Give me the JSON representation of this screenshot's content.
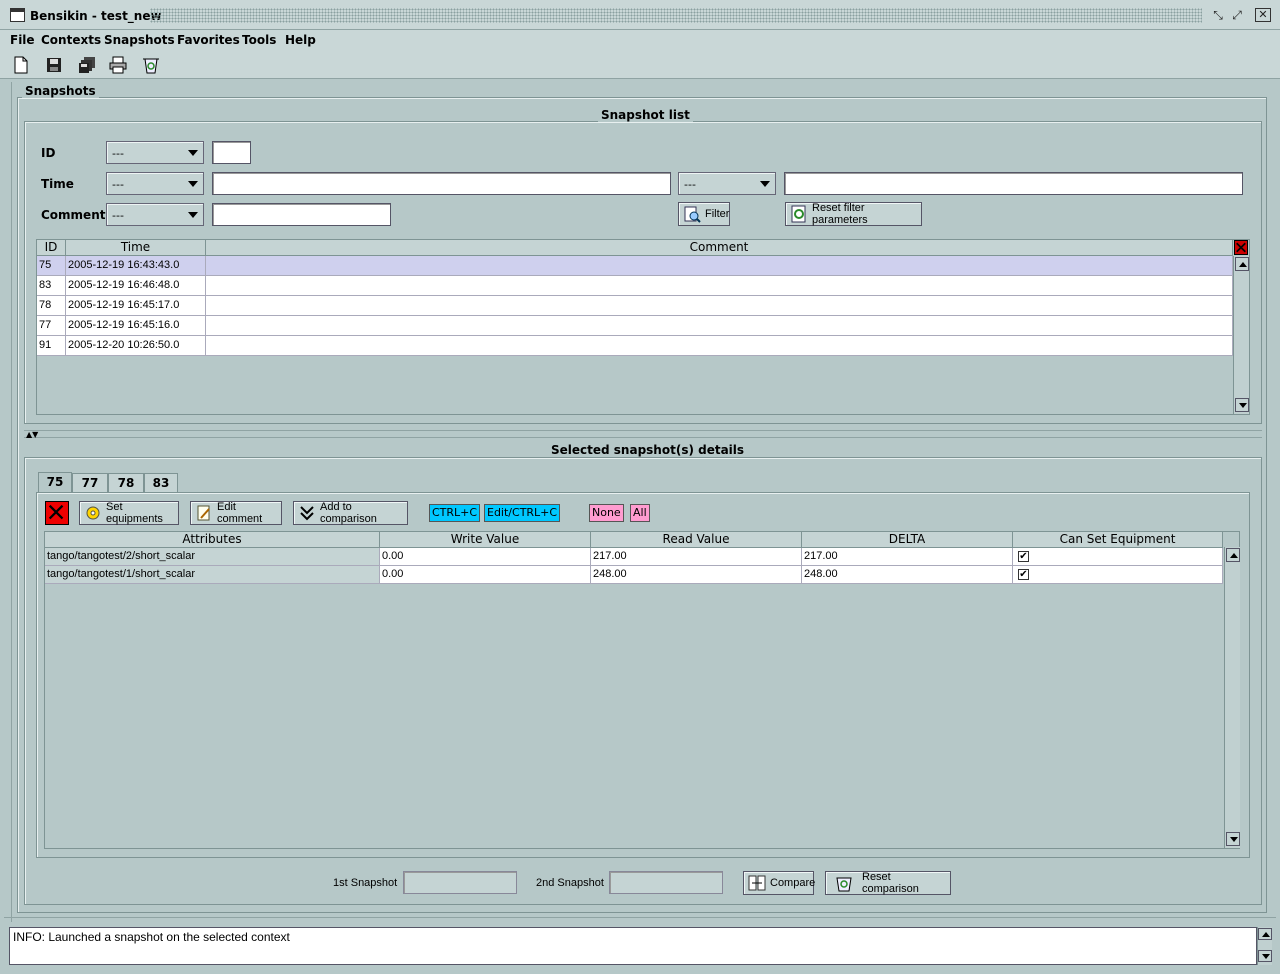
{
  "window": {
    "title": "Bensikin - test_new"
  },
  "menu": [
    "File",
    "Contexts",
    "Snapshots",
    "Favorites",
    "Tools",
    "Help"
  ],
  "toolbar": {
    "icons": [
      "new-file-icon",
      "save-icon",
      "save-all-icon",
      "print-icon",
      "recycle-bin-icon"
    ]
  },
  "panel": {
    "title": "Snapshots"
  },
  "snapshot_list": {
    "title": "Snapshot list",
    "filters": {
      "id_label": "ID",
      "id_combo": "---",
      "id_value": "",
      "time_label": "Time",
      "time_combo": "---",
      "time_value": "",
      "time_combo2": "---",
      "time_value2": "",
      "comment_label": "Comment",
      "comment_combo": "---",
      "comment_value": ""
    },
    "filter_button": "Filter",
    "reset_filter_button": "Reset filter parameters",
    "columns": [
      "ID",
      "Time",
      "Comment"
    ],
    "rows": [
      {
        "id": "75",
        "time": "2005-12-19 16:43:43.0",
        "comment": ""
      },
      {
        "id": "83",
        "time": "2005-12-19 16:46:48.0",
        "comment": ""
      },
      {
        "id": "78",
        "time": "2005-12-19 16:45:17.0",
        "comment": ""
      },
      {
        "id": "77",
        "time": "2005-12-19 16:45:16.0",
        "comment": ""
      },
      {
        "id": "91",
        "time": "2005-12-20 10:26:50.0",
        "comment": ""
      }
    ]
  },
  "details": {
    "title": "Selected snapshot(s) details",
    "tabs": [
      "75",
      "77",
      "78",
      "83"
    ],
    "buttons": {
      "set_equipments": "Set equipments",
      "edit_comment": "Edit comment",
      "add_to_comparison": "Add to comparison",
      "ctrl_c": "CTRL+C",
      "edit_ctrl_c": "Edit/CTRL+C",
      "none": "None",
      "all": "All"
    },
    "columns": [
      "Attributes",
      "Write Value",
      "Read Value",
      "DELTA",
      "Can Set Equipment"
    ],
    "rows": [
      {
        "attribute": "tango/tangotest/2/short_scalar",
        "write": "0.00",
        "read": "217.00",
        "delta": "217.00",
        "can_set": "✔"
      },
      {
        "attribute": "tango/tangotest/1/short_scalar",
        "write": "0.00",
        "read": "248.00",
        "delta": "248.00",
        "can_set": "✔"
      }
    ]
  },
  "comparison": {
    "first_label": "1st Snapshot",
    "first_value": "",
    "second_label": "2nd Snapshot",
    "second_value": "",
    "compare_button": "Compare",
    "reset_button": "Reset comparison"
  },
  "status": {
    "message": "INFO: Launched a snapshot on the selected context"
  },
  "colors": {
    "background": "#b6c8c8",
    "selection": "#cfd0ee",
    "ctrl_chip": "#00c8ff",
    "pink_chip": "#ff9cd0"
  }
}
